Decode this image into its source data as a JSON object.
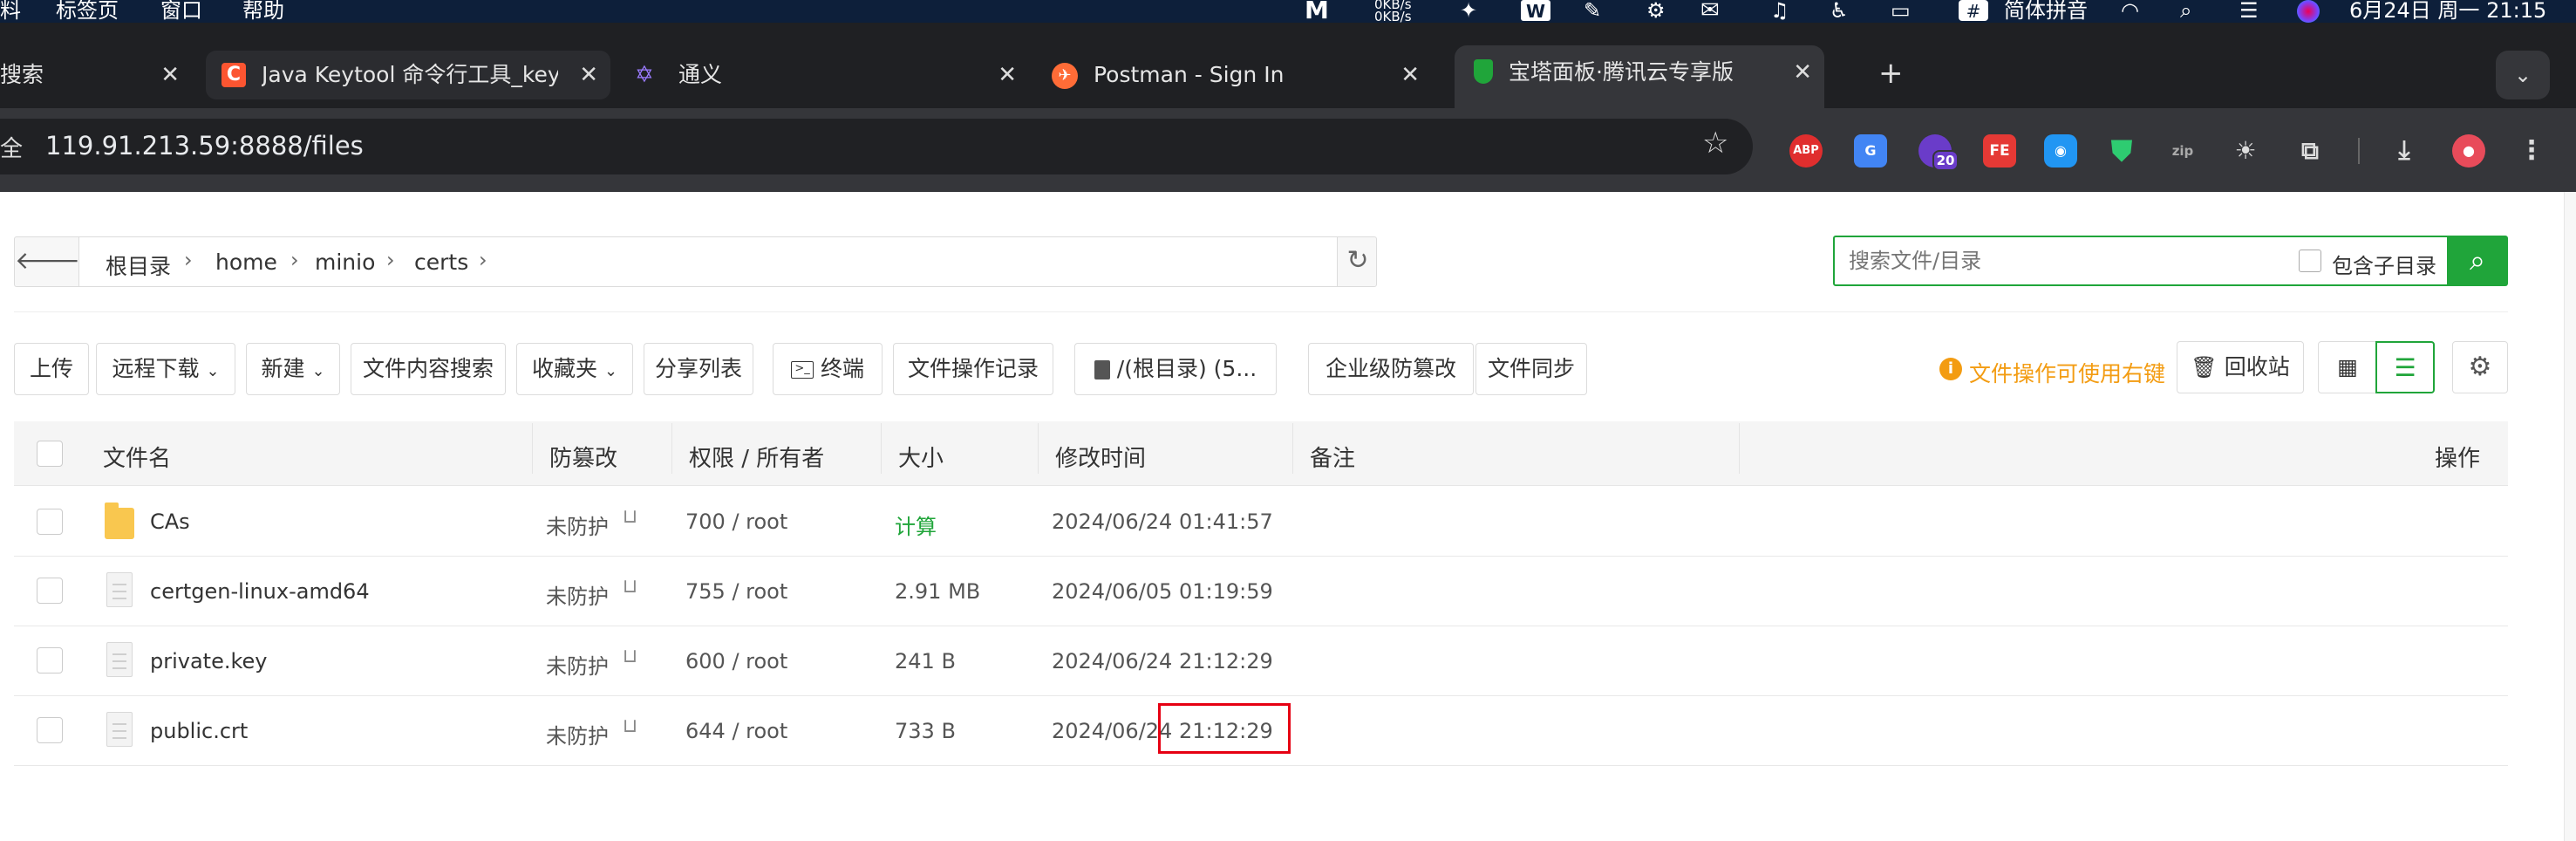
{
  "menubar": {
    "items": [
      "料",
      "标签页",
      "窗口",
      "帮助"
    ],
    "netspeed_up": "0KB/s",
    "netspeed_down": "0KB/s",
    "input_method": "简体拼音",
    "datetime": "6月24日 周一 21:15"
  },
  "tabs": [
    {
      "label": "搜索"
    },
    {
      "label": "Java Keytool 命令行工具_keyto"
    },
    {
      "label": "通义"
    },
    {
      "label": "Postman - Sign In"
    },
    {
      "label": "宝塔面板·腾讯云专享版"
    }
  ],
  "address_bar": {
    "security_label": "全",
    "url": "119.91.213.59:8888/files"
  },
  "extensions": {
    "abp": "ABP",
    "badge": "20",
    "fe": "FE"
  },
  "breadcrumb": [
    "根目录",
    "home",
    "minio",
    "certs"
  ],
  "search": {
    "placeholder": "搜索文件/目录",
    "include_sub": "包含子目录"
  },
  "toolbar": {
    "upload": "上传",
    "remote_download": "远程下载",
    "new": "新建",
    "content_search": "文件内容搜索",
    "favorites": "收藏夹",
    "share_list": "分享列表",
    "terminal": "终端",
    "operation_log": "文件操作记录",
    "disk": "/(根目录) (5...",
    "tamper_proof": "企业级防篡改",
    "file_sync": "文件同步",
    "hint": "文件操作可使用右键",
    "recycle": "回收站"
  },
  "table": {
    "headers": {
      "name": "文件名",
      "tamper": "防篡改",
      "perm": "权限 / 所有者",
      "size": "大小",
      "mtime": "修改时间",
      "note": "备注",
      "ops": "操作"
    },
    "rows": [
      {
        "name": "CAs",
        "type": "folder",
        "tamper": "未防护",
        "perm": "700 / root",
        "size": "计算",
        "mtime": "2024/06/24 01:41:57"
      },
      {
        "name": "certgen-linux-amd64",
        "type": "file",
        "tamper": "未防护",
        "perm": "755 / root",
        "size": "2.91 MB",
        "mtime": "2024/06/05 01:19:59"
      },
      {
        "name": "private.key",
        "type": "file",
        "tamper": "未防护",
        "perm": "600 / root",
        "size": "241 B",
        "mtime": "2024/06/24 21:12:29"
      },
      {
        "name": "public.crt",
        "type": "file",
        "tamper": "未防护",
        "perm": "644 / root",
        "size": "733 B",
        "mtime": "2024/06/24 21:12:29"
      }
    ]
  },
  "colors": {
    "accent": "#20a53a",
    "warning": "#f39c12",
    "highlight": "#e60012"
  }
}
